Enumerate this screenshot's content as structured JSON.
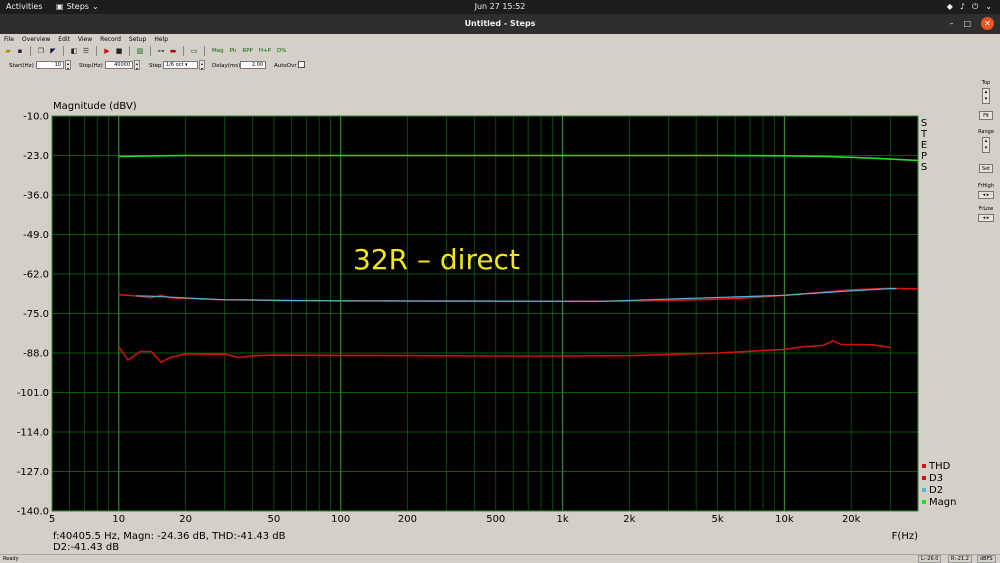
{
  "topbar": {
    "activities": "Activities",
    "app_name": "Steps",
    "clock": "Jun 27  15:52"
  },
  "window": {
    "title": "Untitled - Steps",
    "minimize": "–",
    "maximize": "□",
    "close": "✕"
  },
  "menu": [
    "File",
    "Overview",
    "Edit",
    "View",
    "Record",
    "Setup",
    "Help"
  ],
  "toolbar": {
    "mag_label": "Mag",
    "ph_label": "Ph",
    "rpp_label": "RPP",
    "hp_label": "H+P",
    "d_label": "D%"
  },
  "params": {
    "start_label": "Start(Hz)",
    "start_value": "10",
    "stop_label": "Stop(Hz)",
    "stop_value": "40000",
    "step_label": "Step",
    "step_value": "1/6 oct",
    "delay_label": "Delay(ms)",
    "delay_value": "2.00",
    "autoovr_label": "AutoOvr"
  },
  "chart_data": {
    "type": "line",
    "title": "Magnitude (dBV)",
    "xlabel": "F(Hz)",
    "x_scale": "log",
    "xlim": [
      5,
      40000
    ],
    "ylim": [
      -140,
      -10
    ],
    "yticks": [
      -10.0,
      -23.0,
      -36.0,
      -49.0,
      -62.0,
      -75.0,
      -88.0,
      -101.0,
      -114.0,
      -127.0,
      -140.0
    ],
    "yticklabels": [
      "-10.0",
      "-23.0",
      "-36.0",
      "-49.0",
      "-62.0",
      "-75.0",
      "-88.0",
      "-101.0",
      "-114.0",
      "-127.0",
      "-140.0"
    ],
    "xticks": [
      5,
      10,
      20,
      50,
      100,
      200,
      500,
      1000,
      2000,
      5000,
      10000,
      20000
    ],
    "xticklabels": [
      "5",
      "10",
      "20",
      "50",
      "100",
      "200",
      "500",
      "1k",
      "2k",
      "5k",
      "10k",
      "20k"
    ],
    "grid": true,
    "background": "#000000",
    "grid_color": "#0a5a0a",
    "annotation": "32R – direct",
    "annotation_color": "#f2e616",
    "side_label": "STEPS",
    "legend_position": "bottom-right",
    "legend": [
      "THD",
      "D3",
      "D2",
      "Magn"
    ],
    "series": [
      {
        "name": "Magn",
        "color": "#22dd22",
        "x": [
          10,
          15,
          20,
          50,
          100,
          200,
          500,
          1000,
          2000,
          5000,
          10000,
          15000,
          20000,
          25000,
          30000,
          35000,
          40000
        ],
        "y": [
          -23.3,
          -23.1,
          -23.0,
          -23.0,
          -23.0,
          -23.0,
          -23.0,
          -23.0,
          -23.0,
          -23.0,
          -23.1,
          -23.3,
          -23.6,
          -23.9,
          -24.2,
          -24.4,
          -24.6
        ]
      },
      {
        "name": "THD",
        "color": "#dd1111",
        "x": [
          10,
          12,
          14,
          15.5,
          17,
          20,
          25,
          30,
          40,
          50,
          70,
          100,
          200,
          500,
          1000,
          2000,
          3000,
          5000,
          7000,
          10000,
          15000,
          20000,
          30000,
          40000
        ],
        "y": [
          -68.8,
          -69.2,
          -69.8,
          -69.0,
          -69.8,
          -70.0,
          -70.3,
          -70.5,
          -70.6,
          -70.7,
          -70.8,
          -70.9,
          -70.9,
          -71.0,
          -71.0,
          -70.9,
          -70.7,
          -70.3,
          -69.8,
          -69.0,
          -68.0,
          -67.2,
          -66.7,
          -66.9
        ]
      },
      {
        "name": "D2",
        "color": "#4db8d8",
        "x": [
          12,
          14,
          30,
          35,
          70,
          80,
          200,
          220,
          1300,
          1500,
          10000,
          11000,
          17000,
          18500,
          30000,
          32000
        ],
        "y": [
          -69.2,
          -69.3,
          -70.5,
          -70.5,
          -70.8,
          -70.8,
          -70.9,
          -70.9,
          -71.0,
          -71.0,
          -69.0,
          -68.8,
          -67.9,
          -67.7,
          -66.8,
          -66.8
        ]
      },
      {
        "name": "D3",
        "color": "#cc1111",
        "x": [
          10,
          11,
          12.5,
          14,
          15.5,
          17,
          20,
          25,
          30,
          35,
          40,
          50,
          100,
          200,
          500,
          1000,
          2000,
          5000,
          10000,
          12000,
          15000,
          16500,
          18000,
          20000,
          25000,
          30000
        ],
        "y": [
          -86.0,
          -90.3,
          -87.5,
          -87.5,
          -91.0,
          -89.5,
          -88.3,
          -88.4,
          -88.4,
          -89.5,
          -88.9,
          -88.7,
          -88.8,
          -88.9,
          -89.0,
          -89.0,
          -88.9,
          -88.0,
          -86.8,
          -86.0,
          -85.5,
          -84.0,
          -85.2,
          -85.2,
          -85.3,
          -86.2
        ]
      }
    ]
  },
  "readout": {
    "line1": "f:40405.5 Hz, Magn: -24.36 dB, THD:-41.43  dB",
    "line2": "D2:-41.43 dB"
  },
  "rpanel": {
    "top_label": "Top",
    "fit_label": "Fit",
    "range_label": "Range",
    "set_label": "Set",
    "frhigh_label": "FrHigh",
    "frlow_label": "FrLow"
  },
  "statusbar": {
    "ready": "Ready",
    "left_val": "L:-26.0",
    "right_val": "R:-21.2",
    "unit": "dBFS"
  }
}
